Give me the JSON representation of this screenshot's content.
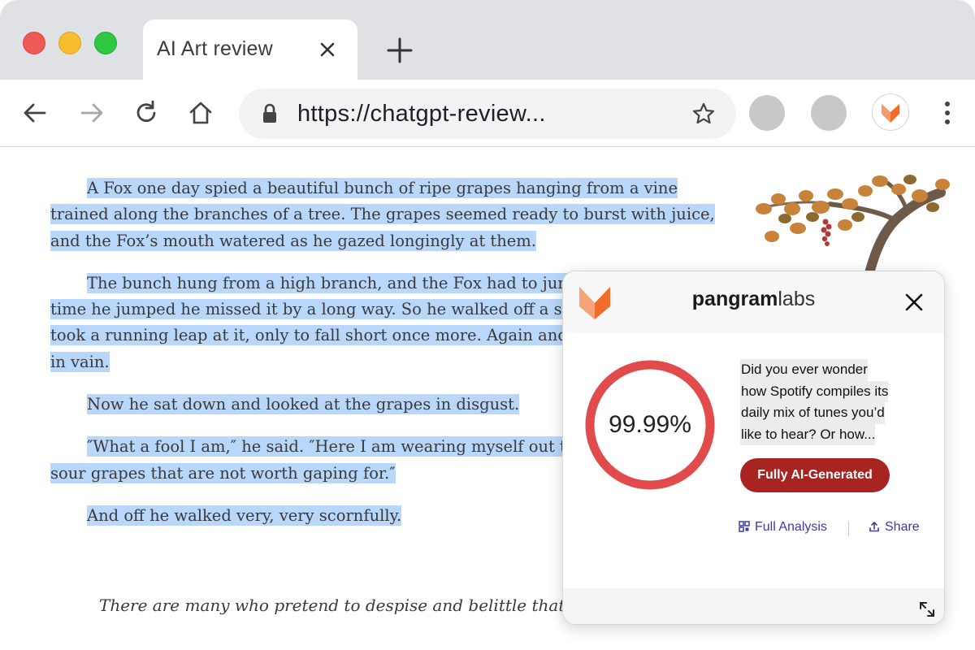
{
  "browser": {
    "tab_title": "AI Art review",
    "url": "https://chatgpt-review..."
  },
  "story": {
    "paragraphs": [
      "A Fox one day spied a beautiful bunch of ripe grapes hanging from a vine trained along the branches of a tree. The grapes seemed ready to burst with juice, and the Fox’s mouth watered as he gazed longingly at them.",
      "The bunch hung from a high branch, and the Fox had to jump for it. The first time he jumped he missed it by a long way. So he walked off a short distance and took a running leap at it, only to fall short once more. Again and again he tried, but in vain.",
      "Now he sat down and looked at the grapes in disgust.",
      "″What a fool I am,″ he said. ″Here I am wearing myself out to get a bunch of sour grapes that are not worth gaping for.″",
      "And off he walked very, very scornfully."
    ],
    "moral": "There are many who pretend to despise and belittle that which is beyond their reach."
  },
  "popup": {
    "brand_bold": "pangram",
    "brand_light": "labs",
    "score": "99.99%",
    "score_fraction": 0.9999,
    "preview_lines": [
      "Did you ever wonder",
      "how Spotify compiles its",
      "daily mix of tunes you’d",
      "like to hear? Or how..."
    ],
    "verdict": "Fully AI-Generated",
    "full_analysis_label": "Full Analysis",
    "share_label": "Share"
  },
  "colors": {
    "accent_red": "#e24b4b",
    "verdict_red": "#a82420",
    "selection": "#b9d7fb",
    "link": "#3e3aa8",
    "fox_orange": "#f26b2a"
  },
  "icons": [
    "back-icon",
    "forward-icon",
    "reload-icon",
    "home-icon",
    "lock-icon",
    "star-icon",
    "close-icon",
    "plus-icon",
    "kebab-icon",
    "fox-logo-icon",
    "qr-icon",
    "share-icon",
    "expand-icon"
  ]
}
